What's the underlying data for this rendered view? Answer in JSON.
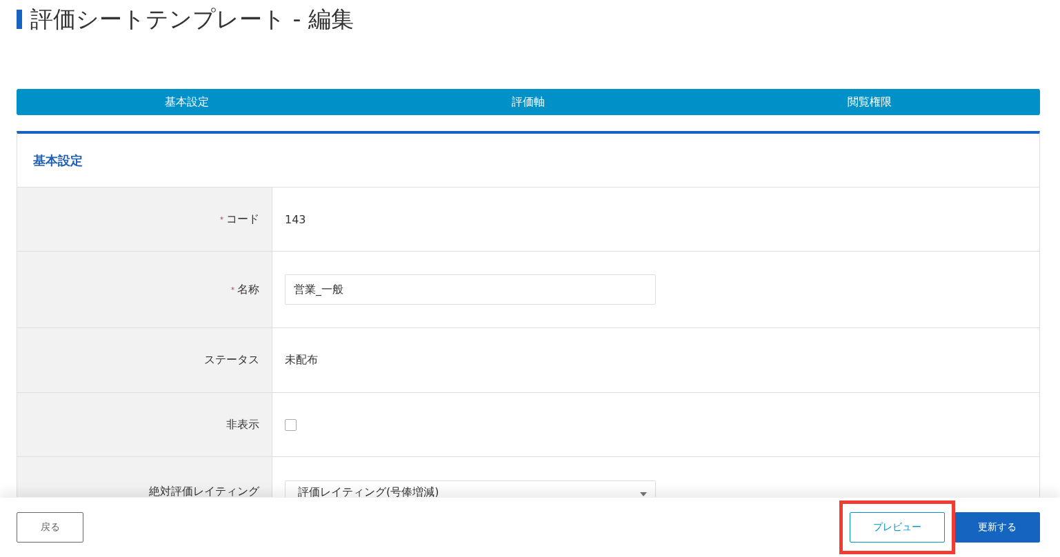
{
  "page_title": "評価シートテンプレート - 編集",
  "tabs": [
    {
      "label": "基本設定"
    },
    {
      "label": "評価軸"
    },
    {
      "label": "閲覧権限"
    }
  ],
  "section": {
    "title": "基本設定",
    "rows": [
      {
        "label": "コード",
        "required_mark": "*",
        "kind": "text",
        "value": "143"
      },
      {
        "label": "名称",
        "required_mark": "*",
        "kind": "input",
        "value": "営業_一般"
      },
      {
        "label": "ステータス",
        "kind": "text",
        "value": "未配布"
      },
      {
        "label": "非表示",
        "kind": "checkbox",
        "checked": false
      },
      {
        "label": "絶対評価レイティング",
        "kind": "select",
        "value": "評価レイティング(号俸増減)"
      }
    ]
  },
  "footer": {
    "back": "戻る",
    "preview": {
      "label": "プレビュー",
      "highlighted": true
    },
    "update": "更新する"
  }
}
